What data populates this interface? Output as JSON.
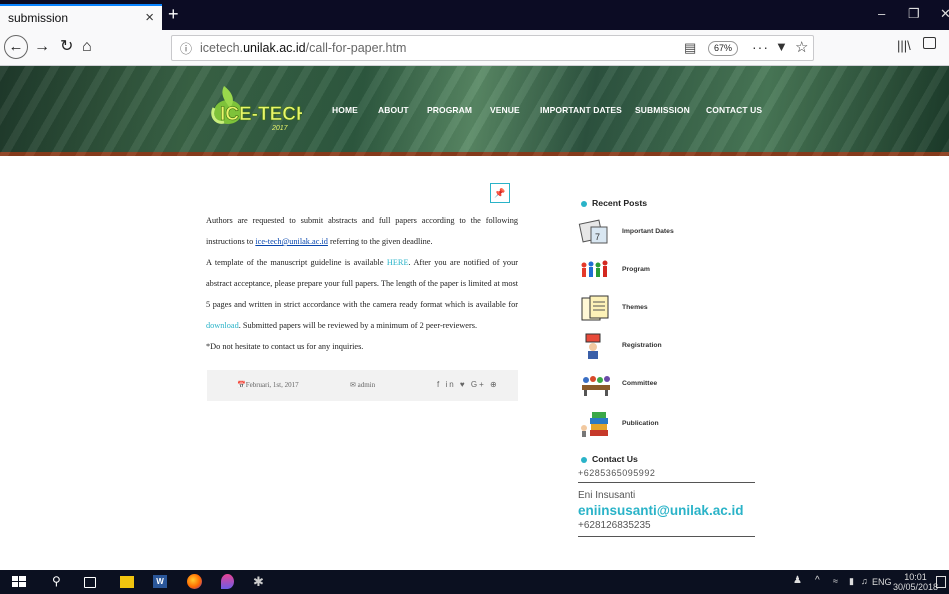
{
  "browser": {
    "tab_title": "submission",
    "tab_close": "×",
    "new_tab": "+",
    "url_prefix": "icetech.",
    "url_domain": "unilak.ac.id",
    "url_path": "/call-for-paper.htm",
    "zoom": "67%",
    "page_actions": "···"
  },
  "site": {
    "logo_text": "ICE-TECH",
    "logo_year": "2017",
    "menu": [
      "HOME",
      "ABOUT",
      "PROGRAM",
      "VENUE",
      "IMPORTANT DATES",
      "SUBMISSION",
      "CONTACT US"
    ]
  },
  "article": {
    "pin_icon": "📌",
    "p1_a": "Authors are requested to submit abstracts and full papers according to the following instructions to ",
    "p1_link": "ice-tech@unilak.ac.id",
    "p1_b": " referring to the given deadline.",
    "p2_a": "A template of the manuscript guideline is available ",
    "p2_link": "HERE",
    "p2_b": ". After you are notified of your abstract acceptance, please prepare your full papers. The length of the paper is limited at most 5 pages and written in strict accordance with the camera ready format which is available for ",
    "p2_link2": "download",
    "p2_c": ". Submitted papers will be reviewed by a minimum of 2 peer-reviewers.",
    "p3": "*Do not  hesitate to contact us for any inquiries.",
    "meta_date": "Februari, 1st, 2017",
    "meta_author": "admin",
    "meta_share": "f in ♥ G+ ⊕"
  },
  "sidebar": {
    "recent_title": "Recent Posts",
    "posts": [
      {
        "label": "Important Dates",
        "icon": "calendar-icon"
      },
      {
        "label": "Program",
        "icon": "people-icon"
      },
      {
        "label": "Themes",
        "icon": "papers-icon"
      },
      {
        "label": "Registration",
        "icon": "registration-icon"
      },
      {
        "label": "Committee",
        "icon": "meeting-icon"
      },
      {
        "label": "Publication",
        "icon": "books-icon"
      }
    ],
    "contact_title": "Contact Us",
    "contact_cut": "+6285365095992",
    "contact_name": "Eni Insusanti",
    "contact_email": "eniinsusanti@unilak.ac.id",
    "contact_phone": "+628126835235"
  },
  "taskbar": {
    "lang": "ENG",
    "time": "10:01",
    "date": "30/05/2018"
  },
  "colors": {
    "accent": "#2ab3c8",
    "banner_border": "#8b3d1c"
  }
}
